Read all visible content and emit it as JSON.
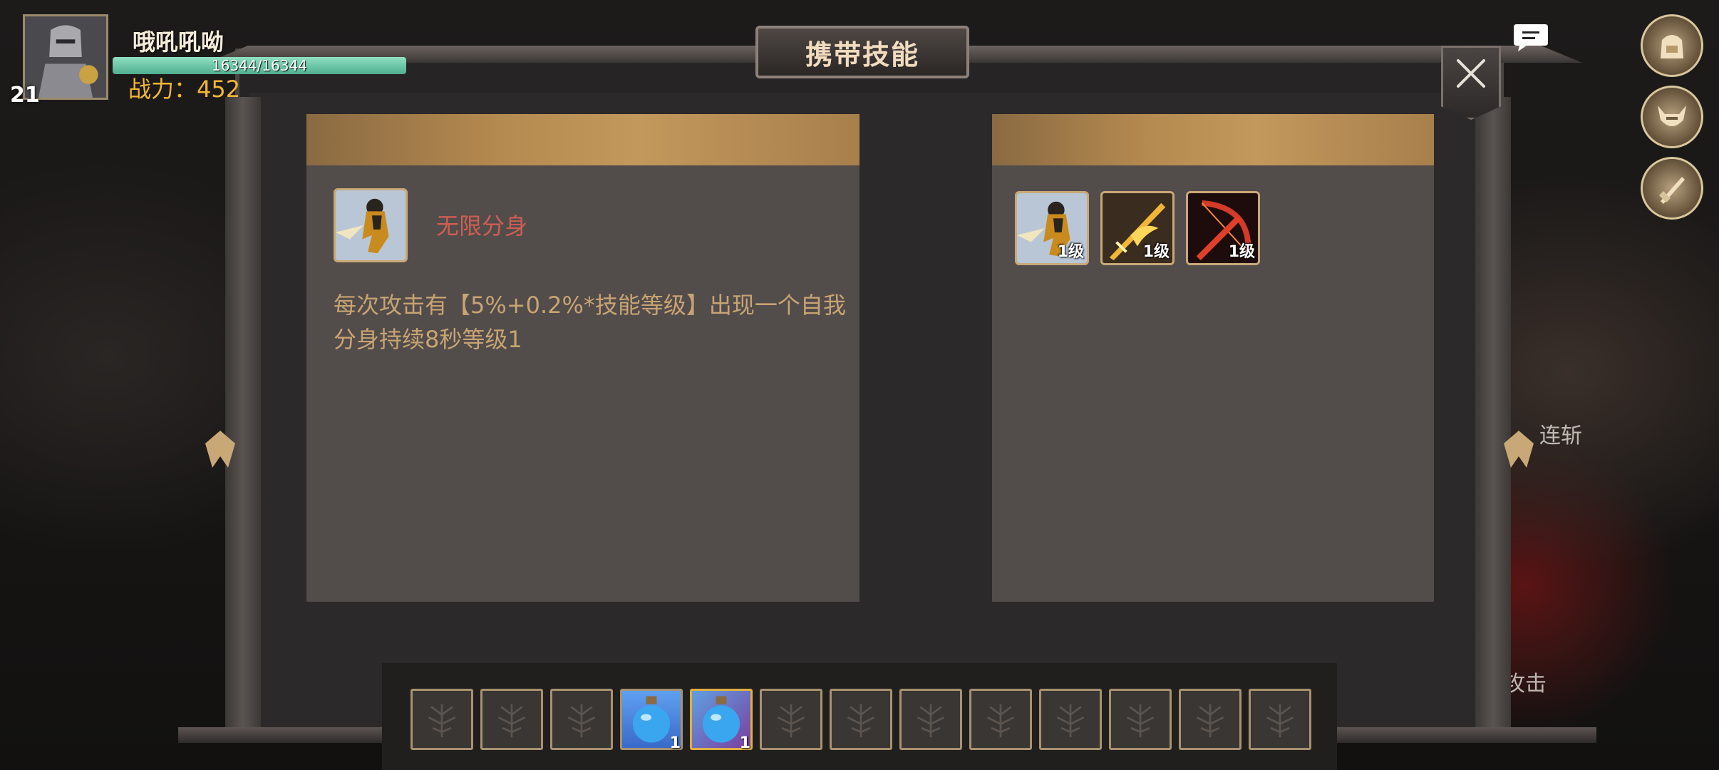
{
  "hud": {
    "player_name": "哦吼吼呦",
    "level": "21",
    "hp_text": "16344/16344",
    "hp_fraction": 1.0,
    "power_label": "战力：",
    "power_value": "452"
  },
  "background_text": {
    "combo_label": "连斩",
    "attack_label": "攻击"
  },
  "dialog": {
    "title": "携带技能",
    "close_icon": "close-icon"
  },
  "selected_skill": {
    "name": "无限分身",
    "description": "每次攻击有【5%+0.2%*技能等级】出现一个自我分身持续8秒等级1",
    "icon": "shadow-clone-icon"
  },
  "carried_skills": [
    {
      "icon": "shadow-clone-icon",
      "level": "1级"
    },
    {
      "icon": "flaming-sword-icon",
      "level": "1级"
    },
    {
      "icon": "red-bow-icon",
      "level": "1级"
    }
  ],
  "item_slots": [
    {
      "item": "empty",
      "count": ""
    },
    {
      "item": "empty",
      "count": ""
    },
    {
      "item": "empty",
      "count": ""
    },
    {
      "item": "blue-potion-icon",
      "count": "1"
    },
    {
      "item": "blue-potion-icon",
      "count": "1"
    },
    {
      "item": "empty",
      "count": ""
    },
    {
      "item": "empty",
      "count": ""
    },
    {
      "item": "empty",
      "count": ""
    },
    {
      "item": "empty",
      "count": ""
    },
    {
      "item": "empty",
      "count": ""
    },
    {
      "item": "empty",
      "count": ""
    },
    {
      "item": "empty",
      "count": ""
    },
    {
      "item": "empty",
      "count": ""
    }
  ],
  "colors": {
    "hp_bar": "#6cc9a6",
    "power_text": "#f2b636",
    "skill_name": "#cf5f52",
    "description": "#c8a472",
    "panel_header": "#b58a50"
  }
}
